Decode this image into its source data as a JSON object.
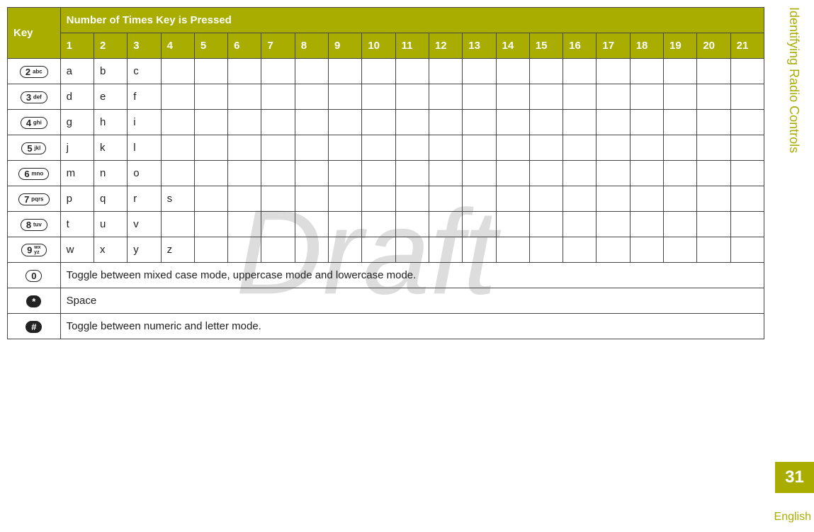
{
  "header": {
    "key_label": "Key",
    "presses_label": "Number of Times Key is Pressed",
    "counts": [
      "1",
      "2",
      "3",
      "4",
      "5",
      "6",
      "7",
      "8",
      "9",
      "10",
      "11",
      "12",
      "13",
      "14",
      "15",
      "16",
      "17",
      "18",
      "19",
      "20",
      "21"
    ]
  },
  "rows": [
    {
      "key_digit": "2",
      "key_letters": "abc",
      "cells": [
        "a",
        "b",
        "c"
      ]
    },
    {
      "key_digit": "3",
      "key_letters": "def",
      "cells": [
        "d",
        "e",
        "f"
      ]
    },
    {
      "key_digit": "4",
      "key_letters": "ghi",
      "cells": [
        "g",
        "h",
        "i"
      ]
    },
    {
      "key_digit": "5",
      "key_letters": "jkl",
      "cells": [
        "j",
        "k",
        "l"
      ]
    },
    {
      "key_digit": "6",
      "key_letters": "mno",
      "cells": [
        "m",
        "n",
        "o"
      ]
    },
    {
      "key_digit": "7",
      "key_letters": "pqrs",
      "cells": [
        "p",
        "q",
        "r",
        "s"
      ]
    },
    {
      "key_digit": "8",
      "key_letters": "tuv",
      "cells": [
        "t",
        "u",
        "v"
      ]
    },
    {
      "key_digit": "9",
      "key_letters": "wx\nyz",
      "stacked": true,
      "cells": [
        "w",
        "x",
        "y",
        "z"
      ]
    },
    {
      "key_digit": "0",
      "key_letters": "",
      "fulltext": "Toggle between mixed case mode, uppercase mode and lowercase mode."
    },
    {
      "key_digit": "*",
      "key_letters": "",
      "symbol": true,
      "fulltext": "Space"
    },
    {
      "key_digit": "#",
      "key_letters": "",
      "symbol": true,
      "fulltext": "Toggle between numeric and letter mode."
    }
  ],
  "sidebar": {
    "section": "Identifying Radio Controls",
    "page": "31",
    "language": "English"
  },
  "watermark": "Draft"
}
